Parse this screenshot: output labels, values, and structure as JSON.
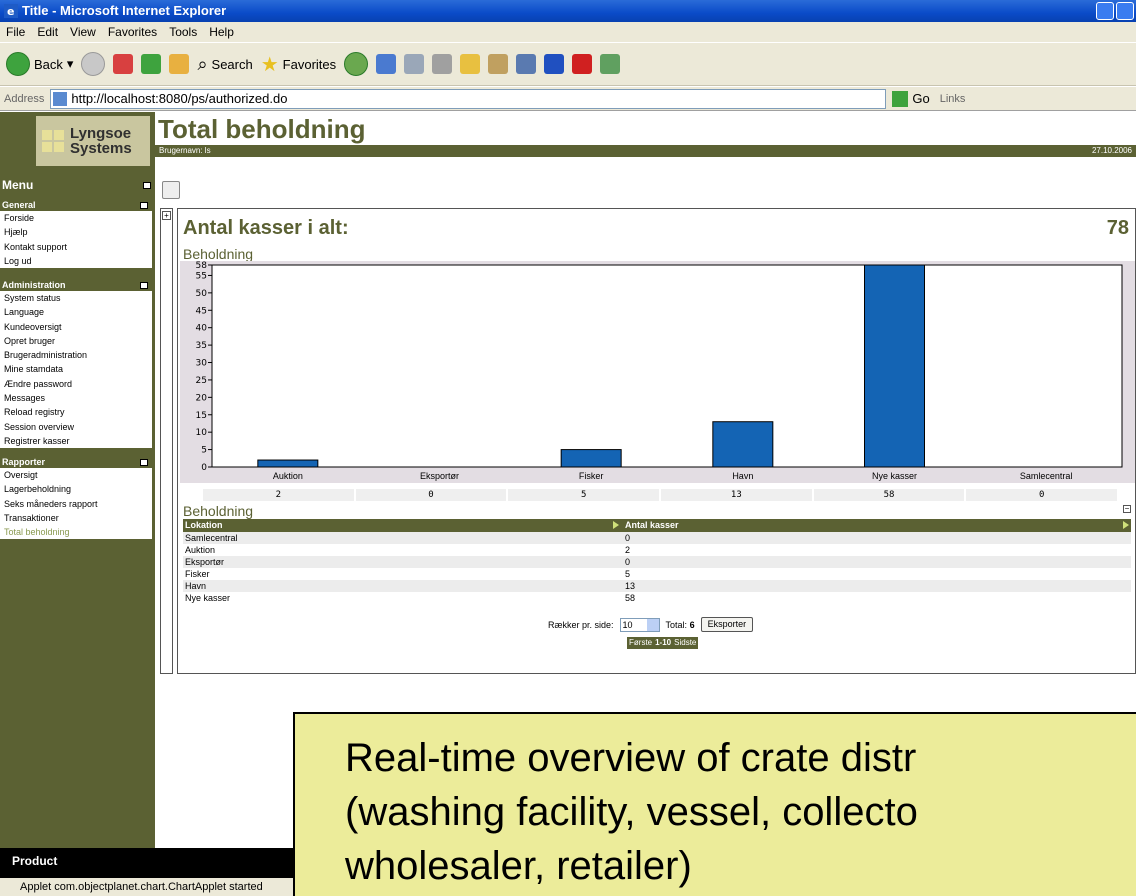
{
  "window": {
    "title": "Title - Microsoft Internet Explorer"
  },
  "menubar": [
    "File",
    "Edit",
    "View",
    "Favorites",
    "Tools",
    "Help"
  ],
  "toolbar": {
    "back": "Back",
    "search": "Search",
    "favorites": "Favorites"
  },
  "address": {
    "label": "Address",
    "url": "http://localhost:8080/ps/authorized.do",
    "go": "Go",
    "links": "Links"
  },
  "logo": {
    "line1": "Lyngsoe",
    "line2": "Systems"
  },
  "sidebar": {
    "menu_title": "Menu",
    "general": {
      "title": "General",
      "items": [
        "Forside",
        "Hjælp",
        "Kontakt support",
        "Log ud"
      ]
    },
    "administration": {
      "title": "Administration",
      "items": [
        "System status",
        "Language",
        "Kundeoversigt",
        "Opret bruger",
        "Brugeradministration",
        "Mine stamdata",
        "Ændre password",
        "Messages",
        "Reload registry",
        "Session overview",
        "Registrer kasser"
      ]
    },
    "rapporter": {
      "title": "Rapporter",
      "items": [
        "Oversigt",
        "Lagerbeholdning",
        "Seks måneders rapport",
        "Transaktioner",
        "Total beholdning"
      ]
    },
    "product": "Product"
  },
  "page": {
    "title": "Total beholdning",
    "user": "Brugernavn: ls",
    "date": "27.10.2006"
  },
  "summary": {
    "label": "Antal kasser i alt:",
    "value": "78"
  },
  "chart_section_title": "Beholdning",
  "chart_data": {
    "type": "bar",
    "categories": [
      "Auktion",
      "Eksportør",
      "Fisker",
      "Havn",
      "Nye kasser",
      "Samlecentral"
    ],
    "values": [
      2,
      0,
      5,
      13,
      58,
      0
    ],
    "ylim": [
      0,
      58
    ],
    "yticks": [
      0,
      5,
      10,
      15,
      20,
      25,
      30,
      35,
      40,
      45,
      50,
      55,
      58
    ],
    "bar_color": "#1464b4"
  },
  "table": {
    "title": "Beholdning",
    "headers": [
      "Lokation",
      "Antal kasser"
    ],
    "rows": [
      [
        "Samlecentral",
        "0"
      ],
      [
        "Auktion",
        "2"
      ],
      [
        "Eksportør",
        "0"
      ],
      [
        "Fisker",
        "5"
      ],
      [
        "Havn",
        "13"
      ],
      [
        "Nye kasser",
        "58"
      ]
    ]
  },
  "pager": {
    "rows_label": "Rækker pr. side:",
    "rows_value": "10",
    "total_label": "Total:",
    "total_value": "6",
    "export": "Eksporter",
    "first": "Første",
    "range": "1-10",
    "last": "Sidste"
  },
  "status": {
    "text": "Applet com.objectplanet.chart.ChartApplet started"
  },
  "callout": {
    "line1": "Real-time overview of crate distr",
    "line2": "(washing facility, vessel, collecto",
    "line3": "wholesaler, retailer)"
  }
}
